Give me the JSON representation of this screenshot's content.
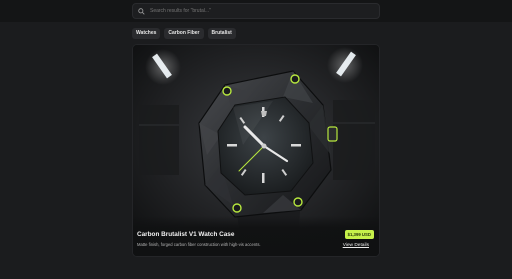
{
  "search": {
    "placeholder": "Search results for \"brutal...\""
  },
  "filters": [
    {
      "label": "Watches"
    },
    {
      "label": "Carbon Fiber"
    },
    {
      "label": "Brutalist"
    }
  ],
  "product": {
    "title": "Carbon Brutalist V1 Watch Case",
    "description": "Matte finish, forged carbon fiber construction with high-vis accents.",
    "price": "$1,399 USD",
    "details_link": "View Details"
  },
  "colors": {
    "accent": "#c6f14a",
    "background": "#1b1c1e",
    "card": "#121314"
  },
  "icons": {
    "search": "search-icon"
  }
}
